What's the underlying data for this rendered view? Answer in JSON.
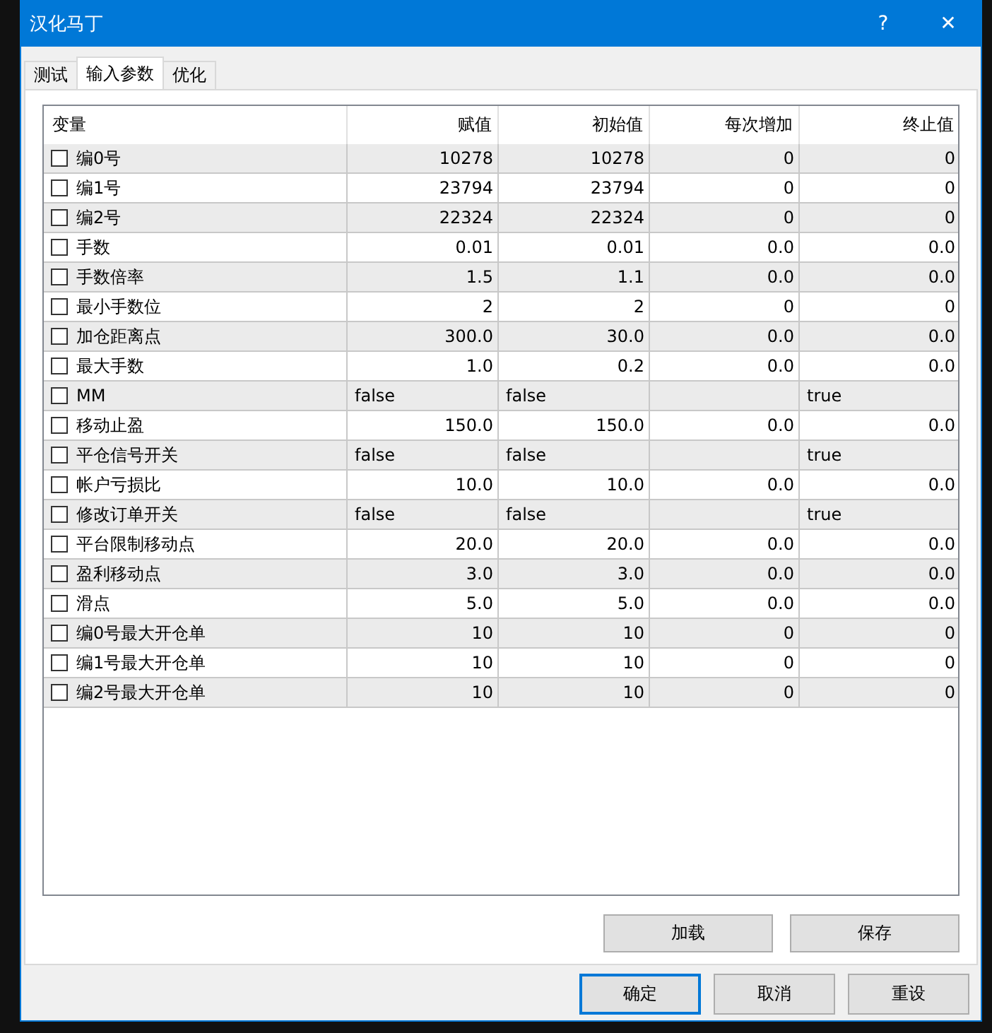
{
  "window": {
    "title": "汉化马丁",
    "help": "?",
    "close": "✕"
  },
  "tabs": [
    {
      "label": "测试",
      "selected": false
    },
    {
      "label": "输入参数",
      "selected": true
    },
    {
      "label": "优化",
      "selected": false
    }
  ],
  "table": {
    "columns": [
      "变量",
      "赋值",
      "初始值",
      "每次增加",
      "终止值"
    ],
    "rows": [
      {
        "kind": "number",
        "checked": false,
        "cells": [
          "编0号",
          "10278",
          "10278",
          "0",
          "0"
        ]
      },
      {
        "kind": "number",
        "checked": false,
        "cells": [
          "编1号",
          "23794",
          "23794",
          "0",
          "0"
        ]
      },
      {
        "kind": "number",
        "checked": false,
        "cells": [
          "编2号",
          "22324",
          "22324",
          "0",
          "0"
        ]
      },
      {
        "kind": "number",
        "checked": false,
        "cells": [
          "手数",
          "0.01",
          "0.01",
          "0.0",
          "0.0"
        ]
      },
      {
        "kind": "number",
        "checked": false,
        "cells": [
          "手数倍率",
          "1.5",
          "1.1",
          "0.0",
          "0.0"
        ]
      },
      {
        "kind": "number",
        "checked": false,
        "cells": [
          "最小手数位",
          "2",
          "2",
          "0",
          "0"
        ]
      },
      {
        "kind": "number",
        "checked": false,
        "cells": [
          "加仓距离点",
          "300.0",
          "30.0",
          "0.0",
          "0.0"
        ]
      },
      {
        "kind": "number",
        "checked": false,
        "cells": [
          "最大手数",
          "1.0",
          "0.2",
          "0.0",
          "0.0"
        ]
      },
      {
        "kind": "bool",
        "checked": false,
        "cells": [
          "MM",
          "false",
          "false",
          "",
          "true"
        ]
      },
      {
        "kind": "number",
        "checked": false,
        "cells": [
          "移动止盈",
          "150.0",
          "150.0",
          "0.0",
          "0.0"
        ]
      },
      {
        "kind": "bool",
        "checked": false,
        "cells": [
          "平仓信号开关",
          "false",
          "false",
          "",
          "true"
        ]
      },
      {
        "kind": "number",
        "checked": false,
        "cells": [
          "帐户亏损比",
          "10.0",
          "10.0",
          "0.0",
          "0.0"
        ]
      },
      {
        "kind": "bool",
        "checked": false,
        "cells": [
          "修改订单开关",
          "false",
          "false",
          "",
          "true"
        ]
      },
      {
        "kind": "number",
        "checked": false,
        "cells": [
          "平台限制移动点",
          "20.0",
          "20.0",
          "0.0",
          "0.0"
        ]
      },
      {
        "kind": "number",
        "checked": false,
        "cells": [
          "盈利移动点",
          "3.0",
          "3.0",
          "0.0",
          "0.0"
        ]
      },
      {
        "kind": "number",
        "checked": false,
        "cells": [
          "滑点",
          "5.0",
          "5.0",
          "0.0",
          "0.0"
        ]
      },
      {
        "kind": "number",
        "checked": false,
        "cells": [
          "编0号最大开仓单",
          "10",
          "10",
          "0",
          "0"
        ]
      },
      {
        "kind": "number",
        "checked": false,
        "cells": [
          "编1号最大开仓单",
          "10",
          "10",
          "0",
          "0"
        ]
      },
      {
        "kind": "number",
        "checked": false,
        "cells": [
          "编2号最大开仓单",
          "10",
          "10",
          "0",
          "0"
        ]
      }
    ]
  },
  "panel_buttons": [
    {
      "label": "加载"
    },
    {
      "label": "保存"
    }
  ],
  "dialog_buttons": [
    {
      "label": "确定",
      "default": true
    },
    {
      "label": "取消",
      "default": false
    },
    {
      "label": "重设",
      "default": false
    }
  ]
}
